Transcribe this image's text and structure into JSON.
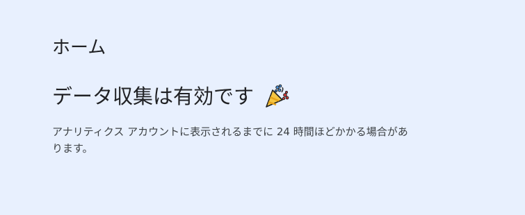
{
  "header": {
    "title": "ホーム"
  },
  "status": {
    "headline": "データ収集は有効です",
    "icon": "party-popper-icon",
    "description": "アナリティクス アカウントに表示されるまでに 24 時間ほどかかる場合があります。"
  }
}
